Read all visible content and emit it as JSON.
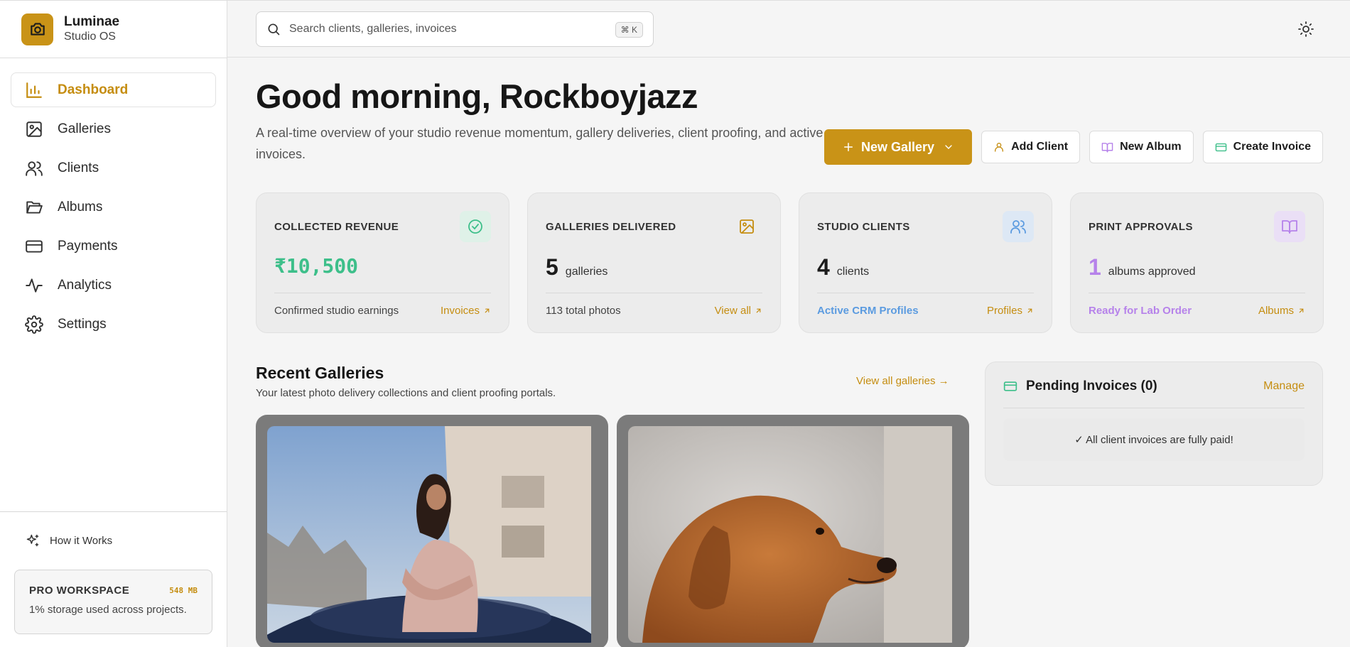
{
  "brand": {
    "name": "Luminae",
    "subtitle": "Studio OS"
  },
  "nav": [
    {
      "label": "Dashboard",
      "icon": "bar-chart-icon",
      "active": true
    },
    {
      "label": "Galleries",
      "icon": "image-icon",
      "active": false
    },
    {
      "label": "Clients",
      "icon": "users-icon",
      "active": false
    },
    {
      "label": "Albums",
      "icon": "folder-open-icon",
      "active": false
    },
    {
      "label": "Payments",
      "icon": "credit-card-icon",
      "active": false
    },
    {
      "label": "Analytics",
      "icon": "activity-icon",
      "active": false
    },
    {
      "label": "Settings",
      "icon": "gear-icon",
      "active": false
    }
  ],
  "sidebar_footer": {
    "how_it_works": "How it Works",
    "workspace_title": "PRO WORKSPACE",
    "workspace_size": "548 MB",
    "workspace_desc": "1% storage used across projects."
  },
  "search": {
    "placeholder": "Search clients, galleries, invoices",
    "shortcut": "⌘ K"
  },
  "header": {
    "greeting": "Good morning, Rockboyjazz",
    "intro": "A real-time overview of your studio revenue momentum, gallery deliveries, client proofing, and active invoices."
  },
  "actions": {
    "new_gallery": "New Gallery",
    "add_client": "Add Client",
    "new_album": "New Album",
    "create_invoice": "Create Invoice"
  },
  "stats": [
    {
      "label": "COLLECTED REVENUE",
      "value": "₹10,500",
      "unit": "",
      "foot": "Confirmed studio earnings",
      "link": "Invoices",
      "value_color": "#3dbf8a",
      "foot_color": "#444444",
      "icon": "check-circle-icon",
      "icon_bg": "#dff1e8",
      "icon_color": "#3dbf8a"
    },
    {
      "label": "GALLERIES DELIVERED",
      "value": "5",
      "unit": "galleries",
      "foot": "113 total photos",
      "link": "View all",
      "value_color": "#1c1c1c",
      "foot_color": "#444444",
      "icon": "image-icon",
      "icon_bg": "#ececec",
      "icon_color": "#c58d10"
    },
    {
      "label": "STUDIO CLIENTS",
      "value": "4",
      "unit": "clients",
      "foot": "Active CRM Profiles",
      "link": "Profiles",
      "value_color": "#1c1c1c",
      "foot_color": "#5b9be0",
      "icon": "users-icon",
      "icon_bg": "#dde8f5",
      "icon_color": "#5b9be0"
    },
    {
      "label": "PRINT APPROVALS",
      "value": "1",
      "unit": "albums approved",
      "foot": "Ready for Lab Order",
      "link": "Albums",
      "value_color": "#b682ea",
      "foot_color": "#b682ea",
      "icon": "book-open-icon",
      "icon_bg": "#eadff6",
      "icon_color": "#b682ea"
    }
  ],
  "recent": {
    "title": "Recent Galleries",
    "subtitle": "Your latest photo delivery collections and client proofing portals.",
    "view_all": "View all galleries →"
  },
  "invoices": {
    "title": "Pending Invoices (0)",
    "manage": "Manage",
    "empty": "✓ All client invoices are fully paid!"
  },
  "colors": {
    "accent": "#c99317",
    "accent_text": "#c58d10"
  }
}
